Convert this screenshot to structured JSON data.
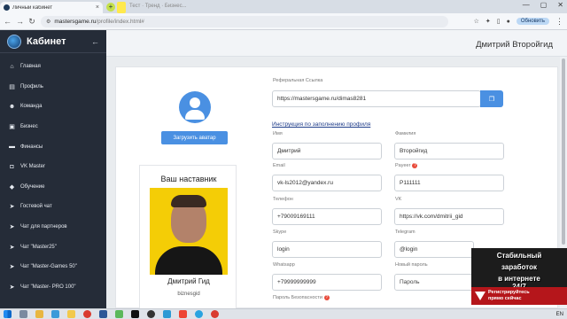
{
  "browser": {
    "tab_title": "Личный кабинет",
    "tab2_title": "Тест · Тренд · Бизнес...",
    "url_host": "mastersgame.ru",
    "url_path": "/profile/index.html#",
    "update_label": "Обновить"
  },
  "sidebar": {
    "brand": "Кабинет",
    "items": [
      {
        "label": "Главная",
        "icon": "home-icon"
      },
      {
        "label": "Профиль",
        "icon": "id-card-icon"
      },
      {
        "label": "Команда",
        "icon": "users-icon"
      },
      {
        "label": "Бизнес",
        "icon": "briefcase-icon"
      },
      {
        "label": "Финансы",
        "icon": "money-icon"
      },
      {
        "label": "VK Master",
        "icon": "vk-icon"
      },
      {
        "label": "Обучение",
        "icon": "graduation-cap-icon"
      },
      {
        "label": "Гостевой чат",
        "icon": "paper-plane-icon"
      },
      {
        "label": "Чат для партнеров",
        "icon": "paper-plane-icon"
      },
      {
        "label": "Чат \"Master25\"",
        "icon": "paper-plane-icon"
      },
      {
        "label": "Чат \"Master-Games 50\"",
        "icon": "paper-plane-icon"
      },
      {
        "label": "Чат \"Master- PRO 100\"",
        "icon": "paper-plane-icon"
      }
    ]
  },
  "header": {
    "user_name": "Дмитрий Второйгид"
  },
  "profile": {
    "upload_avatar": "Загрузить аватар",
    "mentor_heading": "Ваш наставник",
    "mentor_name": "Дмитрий Гид",
    "mentor_login": "biznesgid"
  },
  "form": {
    "ref_label": "Реферальная Ссылка",
    "ref_value": "https://mastersgame.ru/dimas8281",
    "instructions_link": "Инструкция по заполнению профиля",
    "first_name_label": "Имя",
    "first_name": "Дмитрий",
    "last_name_label": "Фамилия",
    "last_name": "Второйгид",
    "email_label": "Email",
    "email": "vk-ls2012@yandex.ru",
    "payeer_label": "Payeer",
    "payeer": "P111111",
    "phone_label": "Телефон",
    "phone": "+79009169111",
    "vk_label": "VK",
    "vk": "https://vk.com/dmitrii_gid",
    "skype_label": "Skype",
    "skype": "login",
    "telegram_label": "Telegram",
    "telegram": "@login",
    "whatsapp_label": "Whatsapp",
    "whatsapp": "+79999999999",
    "password_label": "Новый пароль",
    "password_placeholder": "Пароль",
    "security_password_label": "Пароль Безопасности"
  },
  "promo": {
    "line1": "Стабильный",
    "line2": "заработок",
    "line3": "в интернете",
    "line4": "24/7",
    "cta1": "Регистрируйтесь",
    "cta2": "прямо сейчас"
  },
  "taskbar": {
    "lang": "EN"
  }
}
